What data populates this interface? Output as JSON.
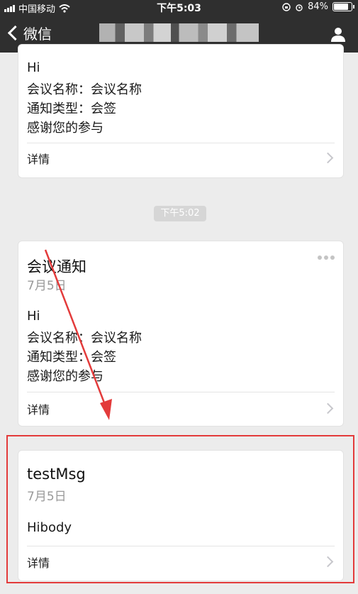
{
  "status_bar": {
    "carrier": "中国移动",
    "time": "下午5:03",
    "battery_percent": "84%",
    "battery_level": 0.84
  },
  "navbar": {
    "back_label": "微信",
    "title_obscured": "",
    "profile_icon": "person-icon"
  },
  "messages": [
    {
      "body": [
        "Hi",
        "会议名称：会议名称",
        "通知类型：会签",
        "感谢您的参与"
      ],
      "detail_label": "详情"
    },
    {
      "timestamp": "下午5:02",
      "title": "会议通知",
      "date": "7月5日",
      "body": [
        "Hi",
        "会议名称：会议名称",
        "通知类型：会签",
        "感谢您的参与"
      ],
      "detail_label": "详情"
    },
    {
      "title": "testMsg",
      "date": "7月5日",
      "body": [
        "Hibody"
      ],
      "detail_label": "详情"
    }
  ],
  "colors": {
    "navbar_bg": "#2f2f2f",
    "page_bg": "#ececec",
    "highlight": "#e33b3b"
  }
}
